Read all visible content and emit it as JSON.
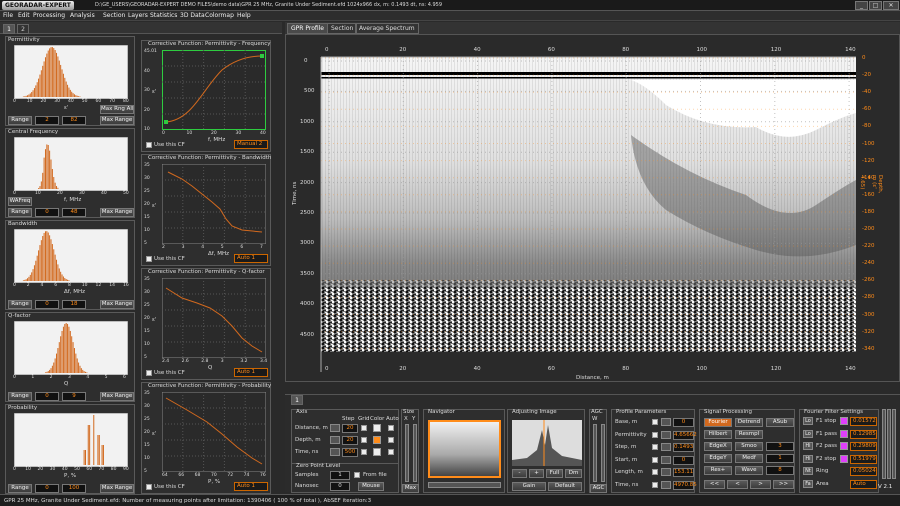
{
  "app": {
    "logo": "GEORADAR-EXPERT",
    "title": "D:\\GE_USERS\\GEORADAR-EXPERT DEMO FILES\\demo data\\GPR 25 MHz, Granite Under Sediment.efd     1024x966    dx, m: 0.1493    dt, ns: 4.959"
  },
  "window": {
    "min": "_",
    "max": "□",
    "close": "✕"
  },
  "menu": [
    "File",
    "Edit",
    "Processing",
    "Analysis",
    "Section",
    "Layers",
    "Statistics",
    "3D Data",
    "Colormap",
    "Help"
  ],
  "left_tabs": [
    "1",
    "2"
  ],
  "histograms": [
    {
      "title": "Permittivity",
      "xlabel": "ε'",
      "ticks": [
        "0",
        "10",
        "20",
        "30",
        "40",
        "50",
        "60",
        "70",
        "80"
      ],
      "from": "2",
      "to": "82",
      "btn_range": "Range",
      "btn_max": "Max Range",
      "btn_extra": "Max Rng All"
    },
    {
      "title": "Central Frequency",
      "xlabel": "f, MHz",
      "ticks": [
        "0",
        "10",
        "20",
        "30",
        "40",
        "50"
      ],
      "from": "0",
      "to": "48",
      "btn_range": "Range",
      "btn_max": "Max Range",
      "btn_extra": "WAFreq"
    },
    {
      "title": "Bandwidth",
      "xlabel": "Δf, MHz",
      "ticks": [
        "0",
        "2",
        "4",
        "6",
        "8",
        "10",
        "12",
        "14",
        "16"
      ],
      "from": "0",
      "to": "18",
      "btn_range": "Range",
      "btn_max": "Max Range",
      "btn_extra": ""
    },
    {
      "title": "Q-factor",
      "xlabel": "Q",
      "ticks": [
        "0",
        "1",
        "2",
        "3",
        "4",
        "5",
        "6"
      ],
      "from": "0",
      "to": "9",
      "btn_range": "Range",
      "btn_max": "Max Range",
      "btn_extra": ""
    },
    {
      "title": "Probability",
      "xlabel": "P, %",
      "ticks": [
        "0",
        "10",
        "20",
        "30",
        "40",
        "50",
        "60",
        "70",
        "80",
        "90"
      ],
      "from": "0",
      "to": "100",
      "btn_range": "Range",
      "btn_max": "Max Range",
      "btn_extra": ""
    }
  ],
  "cf": [
    {
      "title": "Corrective Function: Permittivity - Frequency",
      "ylabel": "ε'",
      "xlabel": "f, MHz",
      "yticks": [
        "45.01",
        "40",
        "30",
        "20",
        "10"
      ],
      "xticks": [
        "0",
        "10",
        "20",
        "30",
        "40"
      ],
      "use": "Use this CF",
      "mode": "Manual 2"
    },
    {
      "title": "Corrective Function: Permittivity - Bandwidth",
      "ylabel": "ε'",
      "xlabel": "Δf, MHz",
      "yticks": [
        "35",
        "30",
        "25",
        "20",
        "15",
        "10",
        "5"
      ],
      "xticks": [
        "2",
        "3",
        "4",
        "5",
        "6",
        "7"
      ],
      "use": "Use this CF",
      "mode": "Auto 1"
    },
    {
      "title": "Corrective Function: Permittivity - Q-factor",
      "ylabel": "ε'",
      "xlabel": "Q",
      "yticks": [
        "35",
        "30",
        "25",
        "20",
        "15",
        "10",
        "5"
      ],
      "xticks": [
        "2.4",
        "2.6",
        "2.8",
        "3",
        "3.2",
        "3.4"
      ],
      "use": "Use this CF",
      "mode": "Auto 1"
    },
    {
      "title": "Corrective Function: Permittivity - Probability",
      "ylabel": "ε'",
      "xlabel": "P, %",
      "yticks": [
        "35",
        "30",
        "25",
        "20",
        "15",
        "10",
        "5"
      ],
      "xticks": [
        "64",
        "66",
        "68",
        "70",
        "72",
        "74",
        "76"
      ],
      "use": "Use this CF",
      "mode": "Auto 1"
    }
  ],
  "view_tabs": [
    "GPR Profile",
    "Section",
    "Average Spectrum"
  ],
  "gpr": {
    "xticks": [
      "0",
      "20",
      "40",
      "60",
      "80",
      "100",
      "120",
      "140"
    ],
    "yticks": [
      "0",
      "500",
      "1000",
      "1500",
      "2000",
      "2500",
      "3000",
      "3500",
      "4000",
      "4500"
    ],
    "dticks": [
      "0",
      "-20",
      "-40",
      "-60",
      "-80",
      "-100",
      "-120",
      "-140",
      "-160",
      "-180",
      "-200",
      "-220",
      "-240",
      "-260",
      "-280",
      "-300",
      "-320",
      "-340"
    ],
    "xlabel": "Distance, m",
    "ylabel": "Time, ns",
    "dlabel": "Depth, m (ε' = 4.65)"
  },
  "bottom_tab": "1",
  "axis": {
    "title": "Axis",
    "cols": [
      "Step",
      "Grid",
      "Color",
      "Auto"
    ],
    "rows": [
      {
        "label": "Distance, m",
        "step": "20"
      },
      {
        "label": "Depth, m",
        "step": "20"
      },
      {
        "label": "Time, ns",
        "step": "500"
      }
    ]
  },
  "zero": {
    "title": "Zero Point Level",
    "samples": "Samples",
    "nanosec": "Nanosec",
    "val1": "1",
    "val2": "0",
    "fromfile": "From file",
    "mouse": "Mouse"
  },
  "size": {
    "title": "Size",
    "x": "X",
    "y": "Y",
    "max": "Max"
  },
  "navigator": {
    "title": "Navigator"
  },
  "adjust": {
    "title": "Adjusting Image",
    "gain": "Gain",
    "default": "Default",
    "btns": [
      "-",
      "+",
      "Full",
      "Dm"
    ]
  },
  "agc": {
    "title": "AGC",
    "w": "W",
    "agc": "AGC"
  },
  "profile": {
    "title": "Profile Parameters",
    "rows": [
      {
        "label": "Base, m",
        "val": "0"
      },
      {
        "label": "Permittivity",
        "val": "4.65662"
      },
      {
        "label": "Step, m",
        "val": "0.1493"
      },
      {
        "label": "Start, m",
        "val": "0"
      },
      {
        "label": "Length, m",
        "val": "153.11"
      },
      {
        "label": "Time, ns",
        "val": "4970.85"
      }
    ]
  },
  "signal": {
    "title": "Signal Processing",
    "grid": [
      [
        "Fourier",
        "Detrend",
        "ASub"
      ],
      [
        "Hilbert",
        "Resmpl",
        ""
      ],
      [
        "EdgeX",
        "Smoo",
        "3"
      ],
      [
        "EdgeY",
        "Medf",
        "1"
      ],
      [
        "Res+",
        "Wave",
        "8"
      ]
    ],
    "nav": [
      "<<",
      "<",
      ">",
      ">>"
    ]
  },
  "fourier": {
    "title": "Fourier Filter Settings",
    "rows": [
      {
        "k": "Lo",
        "label": "F1 stop",
        "val": "0.01572"
      },
      {
        "k": "Lo",
        "label": "F1 pass",
        "val": "0.12985"
      },
      {
        "k": "Hi",
        "label": "F2 pass",
        "val": "0.29809"
      },
      {
        "k": "Hi",
        "label": "F2 stop",
        "val": "0.51979"
      },
      {
        "k": "Nt",
        "label": "Ring",
        "val": "0.05024"
      },
      {
        "k": "Fa",
        "label": "Area",
        "val": "Auto"
      }
    ]
  },
  "version": "V 2.1",
  "status": "GPR 25 MHz, Granite Under Sediment.efd:     Number of measuring points after limitation: 1390406  ( 100 % of total ),  AbSEF iteration:3"
}
